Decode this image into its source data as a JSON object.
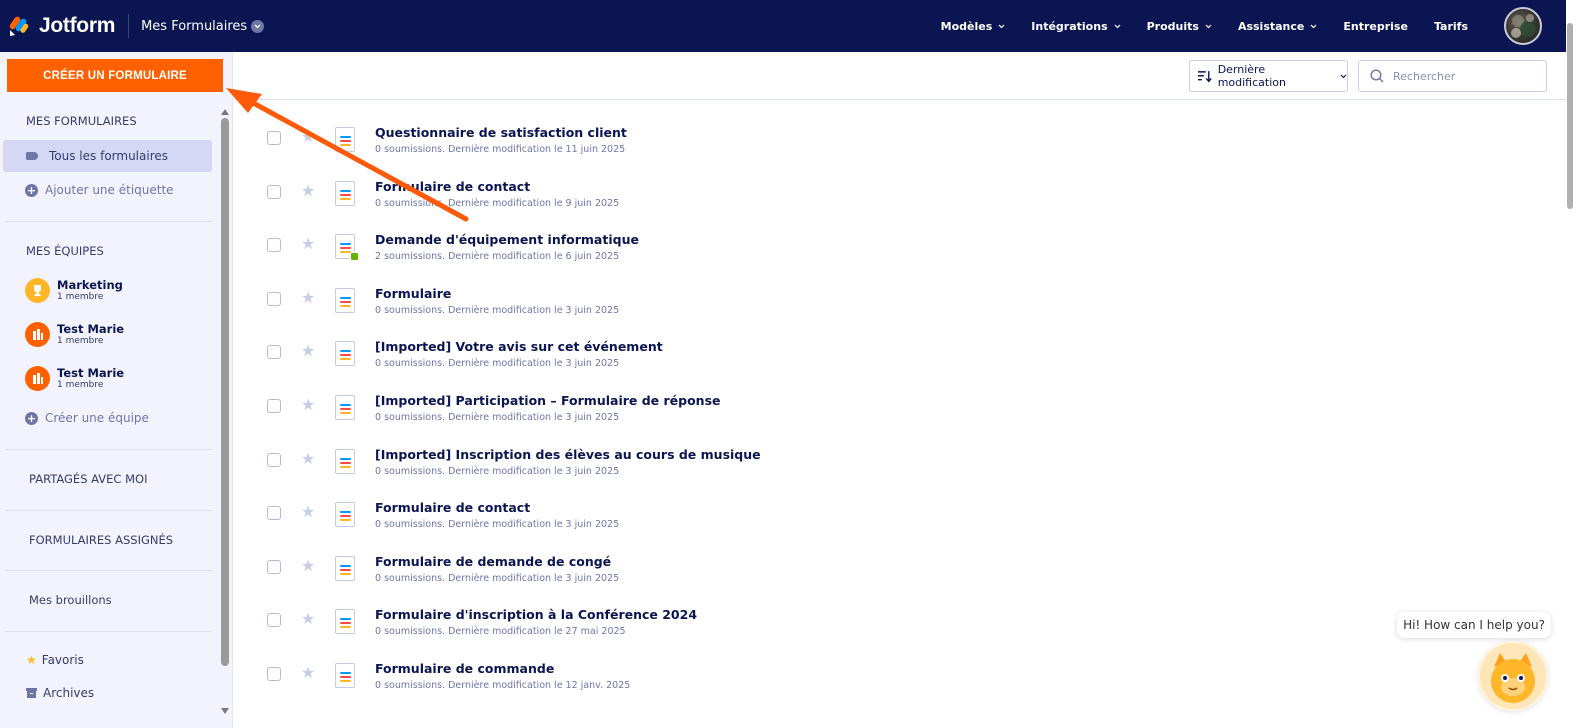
{
  "app": {
    "brand": "Jotform",
    "workspace_label": "Mes Formulaires"
  },
  "nav": {
    "items": [
      {
        "label": "Modèles",
        "has_dropdown": true
      },
      {
        "label": "Intégrations",
        "has_dropdown": true
      },
      {
        "label": "Produits",
        "has_dropdown": true
      },
      {
        "label": "Assistance",
        "has_dropdown": true
      },
      {
        "label": "Entreprise",
        "has_dropdown": false
      },
      {
        "label": "Tarifs",
        "has_dropdown": false
      }
    ]
  },
  "sidebar": {
    "create_button": "CRÉER UN FORMULAIRE",
    "my_forms_title": "MES FORMULAIRES",
    "all_forms": "Tous les formulaires",
    "add_label": "Ajouter une étiquette",
    "my_teams_title": "MES ÉQUIPES",
    "teams": [
      {
        "name": "Marketing",
        "members": "1 membre",
        "color": "#ffb629"
      },
      {
        "name": "Test Marie",
        "members": "1 membre",
        "color": "#ff6100"
      },
      {
        "name": "Test Marie",
        "members": "1 membre",
        "color": "#ff6100"
      }
    ],
    "create_team": "Créer une équipe",
    "shared_with_me": "PARTAGÉS AVEC MOI",
    "assigned_forms": "FORMULAIRES ASSIGNÉS",
    "my_drafts": "Mes brouillons",
    "favorites": "Favoris",
    "archives": "Archives"
  },
  "toolbar": {
    "sort_label": "Dernière modification",
    "search_placeholder": "Rechercher"
  },
  "forms": [
    {
      "title": "Questionnaire de satisfaction client",
      "meta": "0 soumissions. Dernière modification le 11 juin 2025",
      "badge": false
    },
    {
      "title": "Formulaire de contact",
      "meta": "0 soumissions. Dernière modification le 9 juin 2025",
      "badge": false
    },
    {
      "title": "Demande d'équipement informatique",
      "meta": "2 soumissions. Dernière modification le 6 juin 2025",
      "badge": true
    },
    {
      "title": "Formulaire",
      "meta": "0 soumissions. Dernière modification le 3 juin 2025",
      "badge": false
    },
    {
      "title": "[Imported] Votre avis sur cet événement",
      "meta": "0 soumissions. Dernière modification le 3 juin 2025",
      "badge": false
    },
    {
      "title": "[Imported] Participation – Formulaire de réponse",
      "meta": "0 soumissions. Dernière modification le 3 juin 2025",
      "badge": false
    },
    {
      "title": "[Imported] Inscription des élèves au cours de musique",
      "meta": "0 soumissions. Dernière modification le 3 juin 2025",
      "badge": false
    },
    {
      "title": "Formulaire de contact",
      "meta": "0 soumissions. Dernière modification le 3 juin 2025",
      "badge": false
    },
    {
      "title": "Formulaire de demande de congé",
      "meta": "0 soumissions. Dernière modification le 3 juin 2025",
      "badge": false
    },
    {
      "title": "Formulaire d'inscription à la Conférence 2024",
      "meta": "0 soumissions. Dernière modification le 27 mai 2025",
      "badge": false
    },
    {
      "title": "Formulaire de commande",
      "meta": "0 soumissions. Dernière modification le 12 janv. 2025",
      "badge": false
    }
  ],
  "chat": {
    "greeting": "Hi! How can I help you?"
  },
  "colors": {
    "nav_bg": "#0a1551",
    "accent_orange": "#ff6100",
    "sidebar_bg": "#f3f3fe",
    "annotation_arrow": "#ff5a0a"
  },
  "icons": {
    "logo": "jotform-logo-icon",
    "workspace_dropdown": "chevron-down-icon",
    "sort": "sort-icon",
    "search": "search-icon",
    "label": "tag-icon",
    "add": "plus-circle-icon",
    "favorite": "star-icon",
    "archive": "archive-icon",
    "form": "form-icon"
  }
}
